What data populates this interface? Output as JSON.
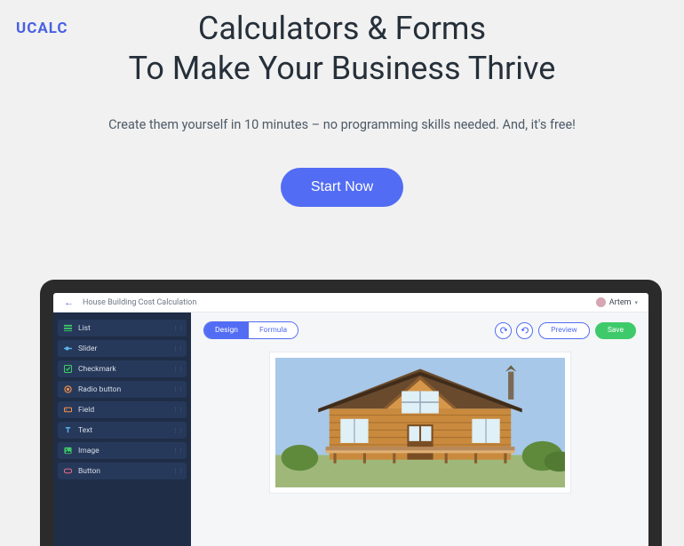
{
  "brand": "uCalc",
  "hero_line1": "Calculators & Forms",
  "hero_line2": "To Make Your Business Thrive",
  "subtitle": "Create them yourself in 10 minutes – no programming skills needed. And, it's free!",
  "cta": "Start Now",
  "app": {
    "breadcrumb": "House Building Cost Calculation",
    "user_name": "Artem",
    "sidebar": [
      {
        "label": "List"
      },
      {
        "label": "Slider"
      },
      {
        "label": "Checkmark"
      },
      {
        "label": "Radio button"
      },
      {
        "label": "Field"
      },
      {
        "label": "Text"
      },
      {
        "label": "Image"
      },
      {
        "label": "Button"
      }
    ],
    "tabs": {
      "design": "Design",
      "formula": "Formula"
    },
    "actions": {
      "preview": "Preview",
      "save": "Save"
    }
  }
}
